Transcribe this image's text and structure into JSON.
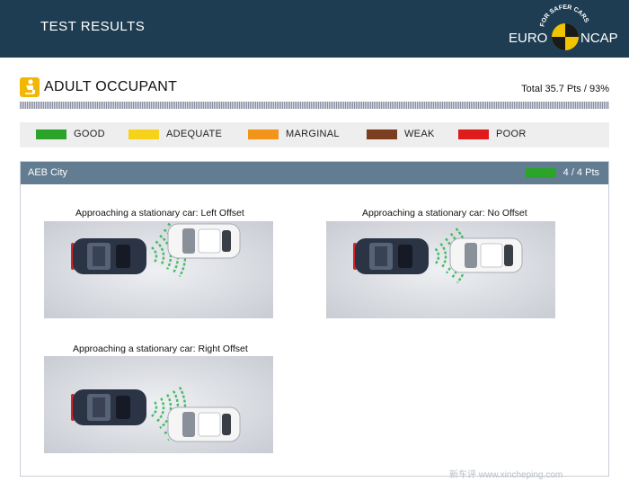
{
  "header": {
    "title": "TEST RESULTS"
  },
  "logo": {
    "arc_text": "FOR SAFER CARS",
    "left": "EURO",
    "right": "NCAP"
  },
  "section": {
    "title": "ADULT OCCUPANT",
    "total": "Total 35.7 Pts / 93%"
  },
  "legend": [
    {
      "label": "GOOD",
      "color": "#2aa52a"
    },
    {
      "label": "ADEQUATE",
      "color": "#f7d21b"
    },
    {
      "label": "MARGINAL",
      "color": "#f2941a"
    },
    {
      "label": "WEAK",
      "color": "#7b3f1f"
    },
    {
      "label": "POOR",
      "color": "#e01b1b"
    }
  ],
  "panel": {
    "title": "AEB City",
    "score": "4 / 4 Pts",
    "score_color": "#2aa52a"
  },
  "scenarios": [
    {
      "caption": "Approaching a stationary car: Left Offset",
      "offset": "left"
    },
    {
      "caption": "Approaching a stationary car: No Offset",
      "offset": "none"
    },
    {
      "caption": "Approaching a stationary car: Right Offset",
      "offset": "right"
    }
  ],
  "watermark": "新车评 www.xincheping.com"
}
